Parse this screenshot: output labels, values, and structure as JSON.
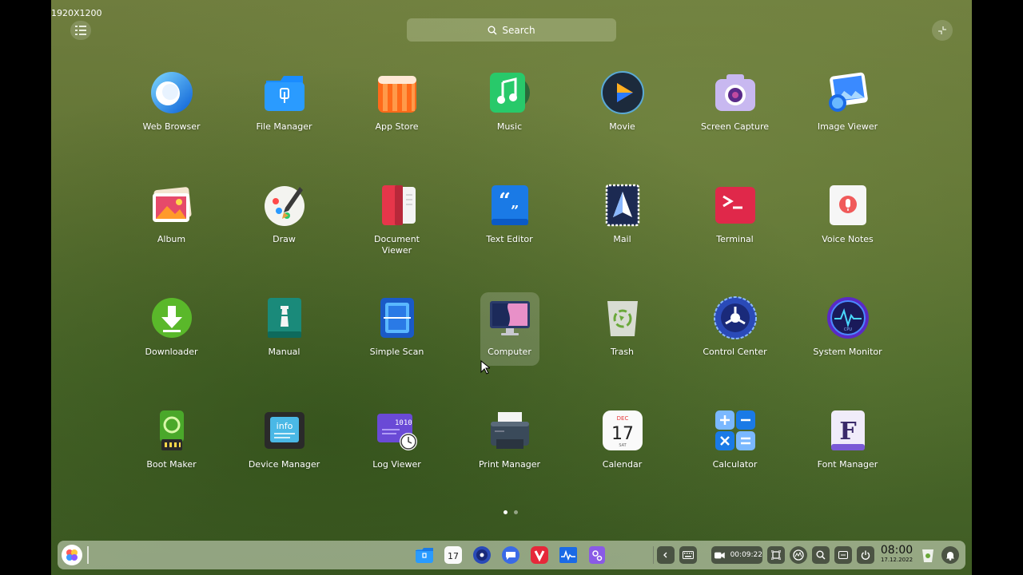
{
  "resolution_label": "1920X1200",
  "search": {
    "label": "Search"
  },
  "apps": [
    {
      "name": "Web Browser",
      "icon": "web-browser-icon"
    },
    {
      "name": "File Manager",
      "icon": "file-manager-icon"
    },
    {
      "name": "App Store",
      "icon": "app-store-icon"
    },
    {
      "name": "Music",
      "icon": "music-icon"
    },
    {
      "name": "Movie",
      "icon": "movie-icon"
    },
    {
      "name": "Screen Capture",
      "icon": "screen-capture-icon"
    },
    {
      "name": "Image Viewer",
      "icon": "image-viewer-icon"
    },
    {
      "name": "Album",
      "icon": "album-icon"
    },
    {
      "name": "Draw",
      "icon": "draw-icon"
    },
    {
      "name": "Document Viewer",
      "icon": "document-viewer-icon"
    },
    {
      "name": "Text Editor",
      "icon": "text-editor-icon"
    },
    {
      "name": "Mail",
      "icon": "mail-icon"
    },
    {
      "name": "Terminal",
      "icon": "terminal-icon"
    },
    {
      "name": "Voice Notes",
      "icon": "voice-notes-icon"
    },
    {
      "name": "Downloader",
      "icon": "downloader-icon"
    },
    {
      "name": "Manual",
      "icon": "manual-icon"
    },
    {
      "name": "Simple Scan",
      "icon": "simple-scan-icon"
    },
    {
      "name": "Computer",
      "icon": "computer-icon",
      "selected": true
    },
    {
      "name": "Trash",
      "icon": "trash-icon"
    },
    {
      "name": "Control Center",
      "icon": "control-center-icon"
    },
    {
      "name": "System Monitor",
      "icon": "system-monitor-icon"
    },
    {
      "name": "Boot Maker",
      "icon": "boot-maker-icon"
    },
    {
      "name": "Device Manager",
      "icon": "device-manager-icon"
    },
    {
      "name": "Log Viewer",
      "icon": "log-viewer-icon"
    },
    {
      "name": "Print Manager",
      "icon": "print-manager-icon"
    },
    {
      "name": "Calendar",
      "icon": "calendar-icon"
    },
    {
      "name": "Calculator",
      "icon": "calculator-icon"
    },
    {
      "name": "Font Manager",
      "icon": "font-manager-icon"
    }
  ],
  "icon_text": {
    "device_manager": "info",
    "log_viewer": "1010",
    "calendar_month": "DEC",
    "calendar_day": "17",
    "calendar_weekday": "SAT",
    "font_manager": "F",
    "system_monitor": "CPU"
  },
  "pagination": {
    "pages": 2,
    "current": 1
  },
  "taskbar": {
    "dock_apps": [
      "file-manager-icon",
      "calendar-icon",
      "control-center-icon",
      "chat-icon",
      "vivaldi-icon",
      "system-monitor-icon",
      "settings-icon"
    ],
    "calendar_day": "17",
    "recording_time": "00:09:22",
    "clock_time": "08:00",
    "clock_date": "17.12.2022"
  },
  "colors": {
    "accent": "#1e8ce6",
    "taskbar": "#dce6d2"
  }
}
